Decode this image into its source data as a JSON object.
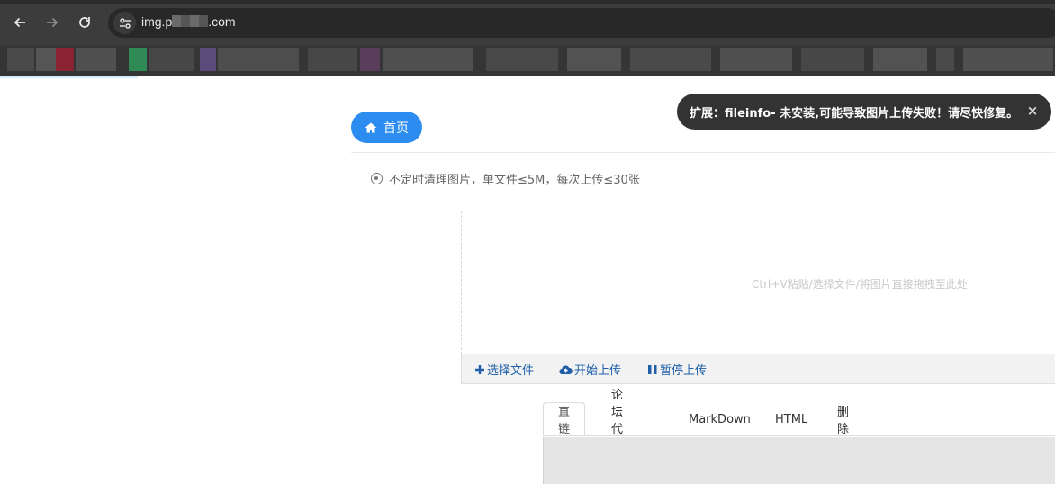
{
  "browser": {
    "url_prefix": "img.p",
    "url_suffix": ".com",
    "back_icon": "arrow-left-icon",
    "forward_icon": "arrow-right-icon",
    "reload_icon": "reload-icon",
    "site_info_icon": "tune-icon"
  },
  "page": {
    "home_label": "首页",
    "notice_text": "不定时清理图片，单文件≤5M，每次上传≤30张",
    "dropzone_hint": "Ctrl+V粘贴/选择文件/将图片直接拖拽至此处",
    "toolbar": {
      "select_label": "选择文件",
      "start_label": "开始上传",
      "pause_label": "暂停上传"
    },
    "tabs": [
      "直链",
      "论坛代码",
      "MarkDown",
      "HTML",
      "删除"
    ],
    "active_tab": "直链"
  },
  "toast": {
    "message": "扩展：fileinfo- 未安装,可能导致图片上传失败！请尽快修复。",
    "close_symbol": "×"
  },
  "colors": {
    "accent": "#2d8cf0",
    "toolbar_link": "#1e5fa8",
    "toast_bg": "#333333"
  }
}
